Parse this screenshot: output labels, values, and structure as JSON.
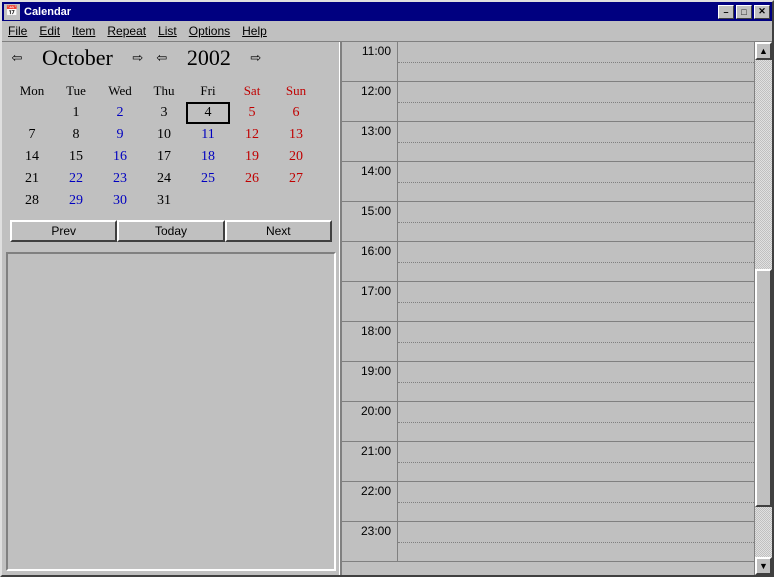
{
  "window": {
    "title": "Calendar",
    "sys_icon": "📅"
  },
  "menu": {
    "file": "File",
    "edit": "Edit",
    "item": "Item",
    "repeat": "Repeat",
    "list": "List",
    "options": "Options",
    "help": "Help"
  },
  "monthbar": {
    "month": "October",
    "year": "2002",
    "prev_month_glyph": "⇦",
    "next_month_glyph": "⇨",
    "prev_year_glyph": "⇦",
    "next_year_glyph": "⇨"
  },
  "dow": [
    "Mon",
    "Tue",
    "Wed",
    "Thu",
    "Fri",
    "Sat",
    "Sun"
  ],
  "weeks": [
    [
      {
        "n": ""
      },
      {
        "n": "1"
      },
      {
        "n": "2",
        "c": "blue"
      },
      {
        "n": "3"
      },
      {
        "n": "4",
        "today": true
      },
      {
        "n": "5",
        "c": "red"
      },
      {
        "n": "6",
        "c": "red"
      }
    ],
    [
      {
        "n": "7"
      },
      {
        "n": "8"
      },
      {
        "n": "9",
        "c": "blue"
      },
      {
        "n": "10"
      },
      {
        "n": "11",
        "c": "blue"
      },
      {
        "n": "12",
        "c": "red"
      },
      {
        "n": "13",
        "c": "red"
      }
    ],
    [
      {
        "n": "14"
      },
      {
        "n": "15"
      },
      {
        "n": "16",
        "c": "blue"
      },
      {
        "n": "17"
      },
      {
        "n": "18",
        "c": "blue"
      },
      {
        "n": "19",
        "c": "red"
      },
      {
        "n": "20",
        "c": "red"
      }
    ],
    [
      {
        "n": "21"
      },
      {
        "n": "22",
        "c": "blue"
      },
      {
        "n": "23",
        "c": "blue"
      },
      {
        "n": "24"
      },
      {
        "n": "25",
        "c": "blue"
      },
      {
        "n": "26",
        "c": "red"
      },
      {
        "n": "27",
        "c": "red"
      }
    ],
    [
      {
        "n": "28"
      },
      {
        "n": "29",
        "c": "blue"
      },
      {
        "n": "30",
        "c": "blue"
      },
      {
        "n": "31"
      },
      {
        "n": ""
      },
      {
        "n": ""
      },
      {
        "n": ""
      }
    ]
  ],
  "nav": {
    "prev": "Prev",
    "today": "Today",
    "next": "Next"
  },
  "time_slots": [
    "11:00",
    "12:00",
    "13:00",
    "14:00",
    "15:00",
    "16:00",
    "17:00",
    "18:00",
    "19:00",
    "20:00",
    "21:00",
    "22:00",
    "23:00"
  ],
  "scroll": {
    "up_glyph": "▲",
    "down_glyph": "▼"
  },
  "ctrl": {
    "min_glyph": "–",
    "max_glyph": "□",
    "close_glyph": "✕"
  }
}
